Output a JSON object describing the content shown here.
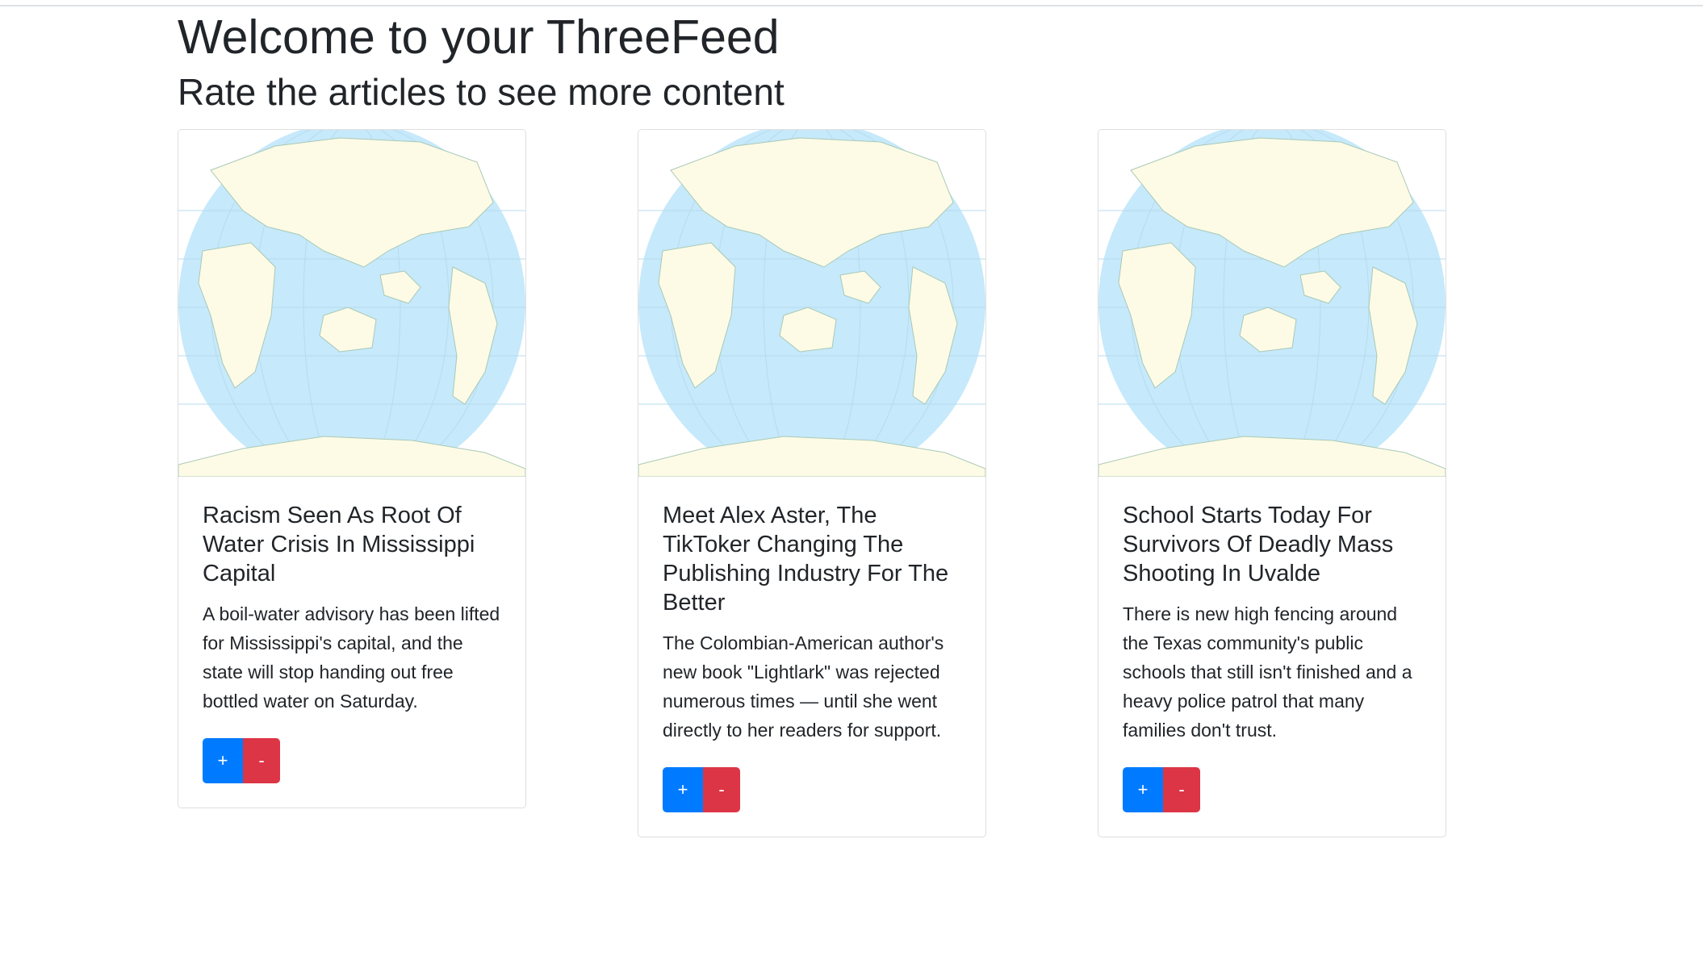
{
  "header": {
    "title": "Welcome to your ThreeFeed",
    "subtitle": "Rate the articles to see more content"
  },
  "colors": {
    "plus_button": "#007bff",
    "minus_button": "#dc3545",
    "ocean": "#c6e9fb",
    "land": "#fdfbe6"
  },
  "articles": [
    {
      "image_icon": "world-map-globe",
      "title": "Racism Seen As Root Of Water Crisis In Mississippi Capital",
      "text": "A boil-water advisory has been lifted for Mississippi's capital, and the state will stop handing out free bottled water on Saturday.",
      "upvote_label": "+",
      "downvote_label": "-"
    },
    {
      "image_icon": "world-map-globe",
      "title": "Meet Alex Aster, The TikToker Changing The Publishing Industry For The Better",
      "text": "The Colombian-American author's new book \"Lightlark\" was rejected numerous times — until she went directly to her readers for support.",
      "upvote_label": "+",
      "downvote_label": "-"
    },
    {
      "image_icon": "world-map-globe",
      "title": "School Starts Today For Survivors Of Deadly Mass Shooting In Uvalde",
      "text": "There is new high fencing around the Texas community's public schools that still isn't finished and a heavy police patrol that many families don't trust.",
      "upvote_label": "+",
      "downvote_label": "-"
    }
  ]
}
